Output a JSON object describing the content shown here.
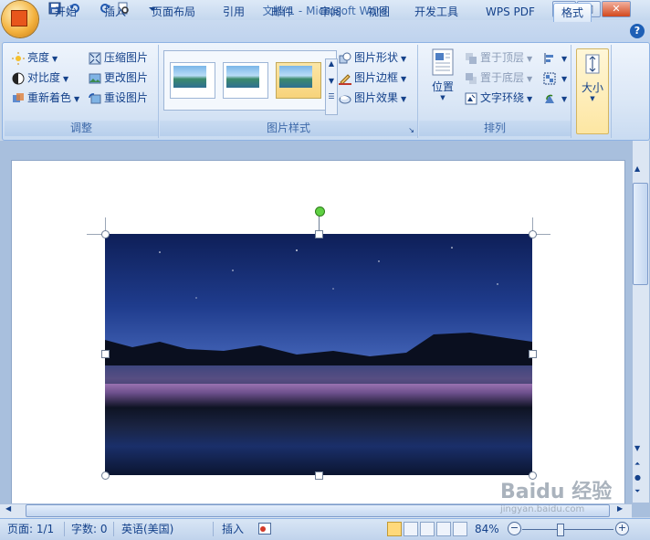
{
  "window": {
    "title": "文档 1 - Microsoft Word",
    "controls": {
      "minimize": "—",
      "maximize": "□",
      "close": "✕"
    }
  },
  "quick_access": {
    "icons": [
      "save-icon",
      "undo-icon",
      "redo-icon",
      "print-preview-icon",
      "customize-icon"
    ]
  },
  "tabs": [
    {
      "label": "开始",
      "active": false
    },
    {
      "label": "插入",
      "active": false
    },
    {
      "label": "页面布局",
      "active": false
    },
    {
      "label": "引用",
      "active": false
    },
    {
      "label": "邮件",
      "active": false
    },
    {
      "label": "审阅",
      "active": false
    },
    {
      "label": "视图",
      "active": false
    },
    {
      "label": "开发工具",
      "active": false
    },
    {
      "label": "WPS PDF",
      "active": false
    },
    {
      "label": "格式",
      "active": true
    }
  ],
  "help_label": "?",
  "ribbon": {
    "adjust": {
      "label": "调整",
      "brightness": "亮度",
      "contrast": "对比度",
      "recolor": "重新着色",
      "compress": "压缩图片",
      "change_picture": "更改图片",
      "reset_picture": "重设图片"
    },
    "picture_styles": {
      "label": "图片样式",
      "shape": "图片形状",
      "border": "图片边框",
      "effects": "图片效果",
      "selected_style_index": 2
    },
    "arrange": {
      "label": "排列",
      "position": "位置",
      "bring_front": "置于顶层",
      "send_back": "置于底层",
      "text_wrap": "文字环绕"
    },
    "size": {
      "label": "大小"
    }
  },
  "status": {
    "page": "页面: 1/1",
    "words": "字数: 0",
    "language": "英语(美国)",
    "insert_mode": "插入",
    "zoom": "84%",
    "zoom_minus": "−",
    "zoom_plus": "+"
  },
  "watermark": {
    "text": "Baidu 经验",
    "url": "jingyan.baidu.com"
  },
  "colors": {
    "accent": "#15428b",
    "active_tab": "#dbe8f7",
    "rotate_handle": "#5fd043"
  }
}
